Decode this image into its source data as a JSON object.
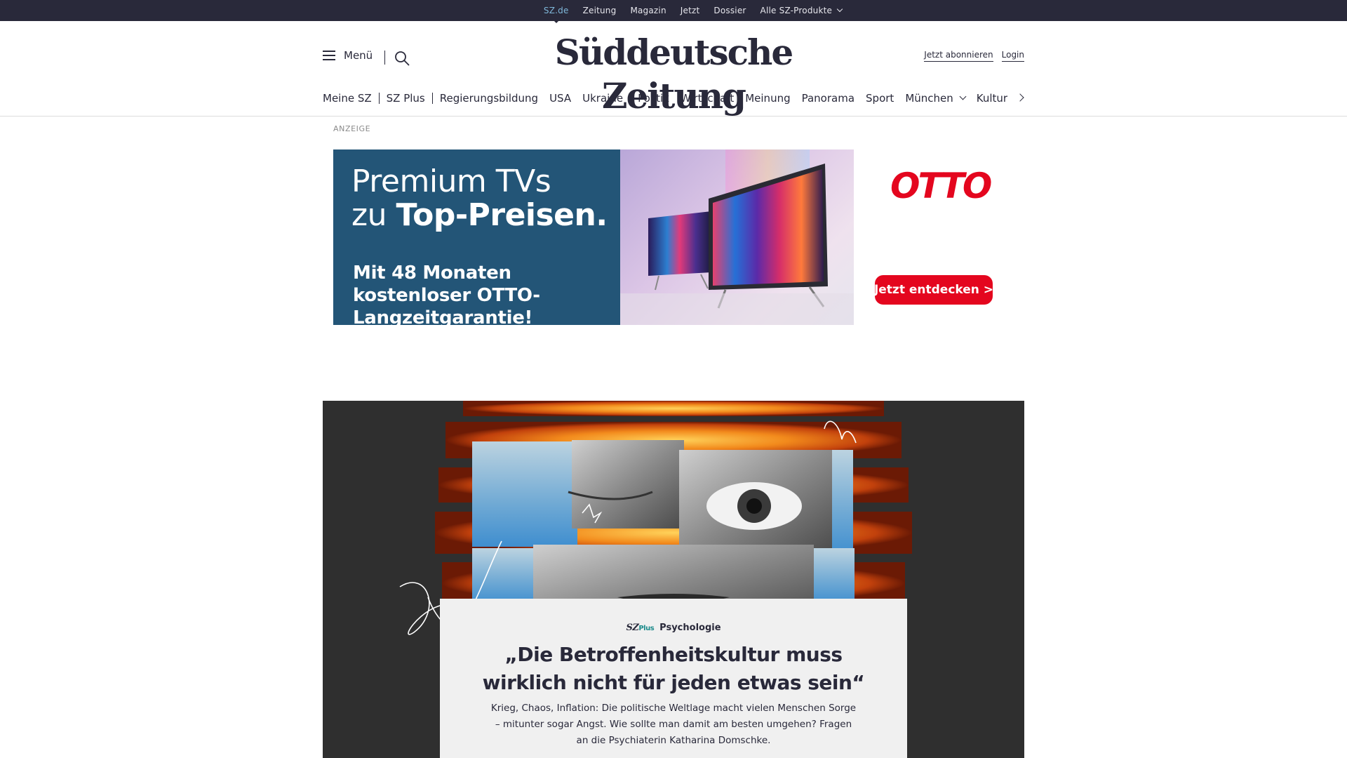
{
  "topbar": {
    "items": [
      "SZ.de",
      "Zeitung",
      "Magazin",
      "Jetzt",
      "Dossier",
      "Alle SZ-Produkte"
    ]
  },
  "header": {
    "menu_label": "Menü",
    "logo": "Süddeutsche Zeitung",
    "subscribe": "Jetzt abonnieren",
    "login": "Login"
  },
  "nav": {
    "items": [
      "Meine SZ",
      "SZ Plus",
      "Regierungsbildung",
      "USA",
      "Ukraine",
      "Politik",
      "Wirtschaft",
      "Meinung",
      "Panorama",
      "Sport",
      "München",
      "Kultur"
    ]
  },
  "ad": {
    "label": "ANZEIGE",
    "headline_line1": "Premium TVs",
    "headline_line2_prefix": "zu ",
    "headline_line2_bold": "Top-Preisen.",
    "subline": "Mit 48 Monaten kostenloser OTTO-Langzeitgarantie!",
    "brand": "OTTO",
    "cta": "Jetzt entdecken >",
    "colors": {
      "panel": "#235577",
      "brand_red": "#e4061e"
    }
  },
  "teaser": {
    "brand_mark": "SZ",
    "brand_plus": "Plus",
    "kicker": "Psychologie",
    "title": "„Die Betroffenheitskultur muss wirklich nicht für jeden etwas sein“",
    "text": "Krieg, Chaos, Inflation: Die politische Weltlage macht vielen Menschen Sorge – mitunter sogar Angst. Wie sollte man damit am besten umgehen? Fragen an die Psychiaterin Katharina Domschke."
  },
  "colors": {
    "dark": "#29293a",
    "active_link": "#7fb7d9",
    "hero_bg": "#2f2f2f",
    "card_bg": "#f0f0f0"
  }
}
